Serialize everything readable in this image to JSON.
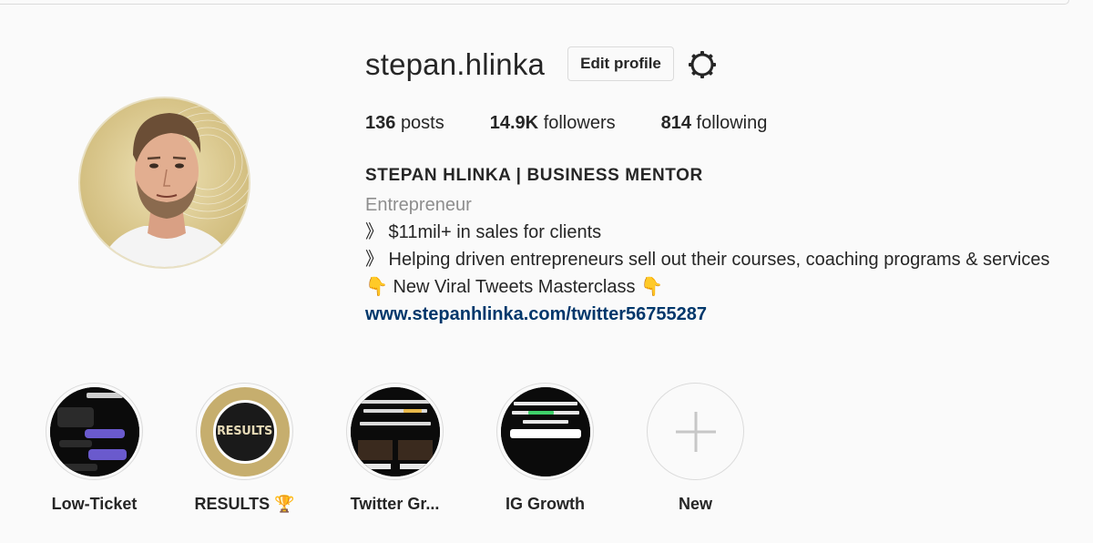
{
  "profile": {
    "username": "stepan.hlinka",
    "edit_profile_label": "Edit profile",
    "settings_icon": "gear-icon"
  },
  "stats": {
    "posts_count": "136",
    "posts_label": "posts",
    "followers_count": "14.9K",
    "followers_label": "followers",
    "following_count": "814",
    "following_label": "following"
  },
  "bio": {
    "name": "STEPAN HLINKA | BUSINESS MENTOR",
    "category": "Entrepreneur",
    "lines": [
      "》 $11mil+ in sales for clients",
      "》 Helping driven entrepreneurs sell out their courses, coaching programs & services",
      "👇 New Viral Tweets Masterclass 👇"
    ],
    "link": "www.stepanhlinka.com/twitter56755287"
  },
  "highlights": [
    {
      "label": "Low-Ticket"
    },
    {
      "label": "RESULTS 🏆",
      "badge_text": "RESULTS"
    },
    {
      "label": "Twitter Gr..."
    },
    {
      "label": "IG Growth"
    },
    {
      "label": "New"
    }
  ],
  "colors": {
    "background": "#fafafa",
    "text": "#262626",
    "muted": "#8e8e8e",
    "link": "#00376b",
    "border": "#dbdbdb",
    "gold": "#c6ae6e"
  }
}
